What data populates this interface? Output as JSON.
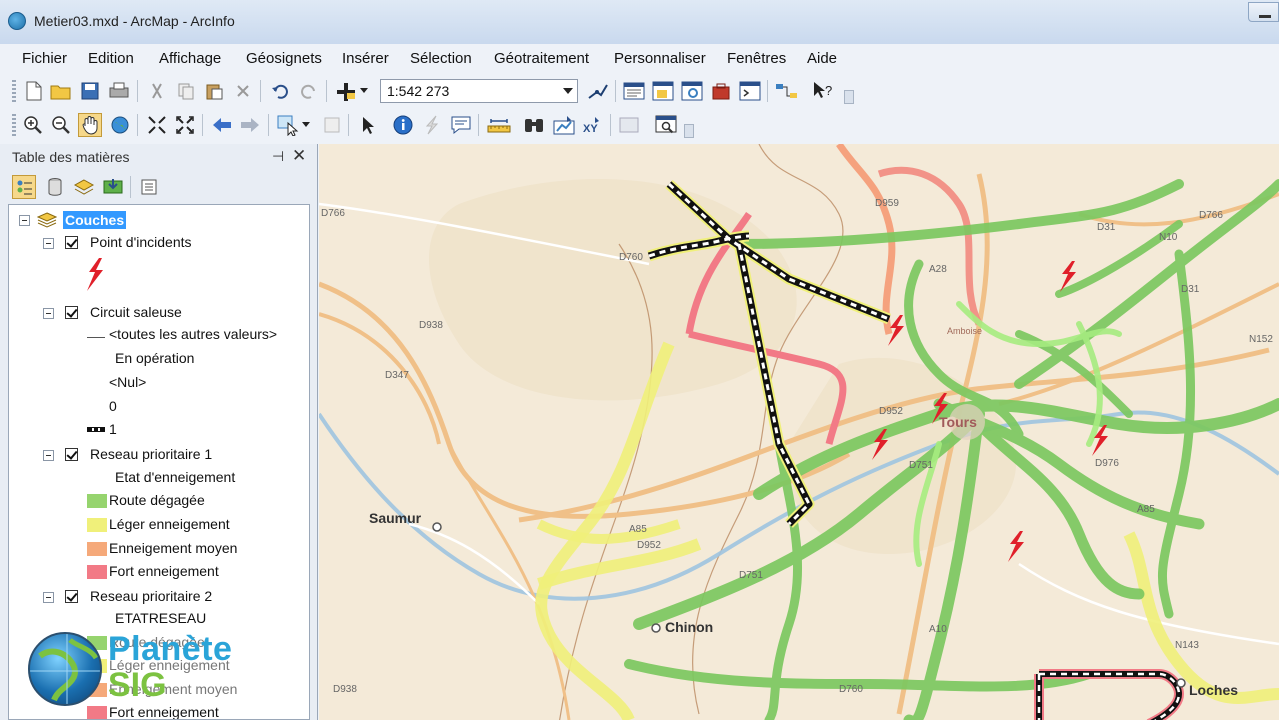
{
  "window": {
    "title": "Metier03.mxd - ArcMap - ArcInfo"
  },
  "menu": [
    "Fichier",
    "Edition",
    "Affichage",
    "Géosignets",
    "Insérer",
    "Sélection",
    "Géotraitement",
    "Personnaliser",
    "Fenêtres",
    "Aide"
  ],
  "toolbar": {
    "scale_value": "1:542 273"
  },
  "toc": {
    "title": "Table des matières",
    "root": "Couches",
    "layer1": {
      "name": "Point d'incidents"
    },
    "layer2": {
      "name": "Circuit saleuse",
      "items": [
        "<toutes les autres valeurs>",
        "En opération",
        "<Nul>",
        "0",
        "1"
      ]
    },
    "layer3": {
      "name": "Reseau prioritaire 1",
      "field": "Etat d'enneigement",
      "classes": [
        {
          "label": "Route dégagée",
          "color": "#96d46e"
        },
        {
          "label": "Léger enneigement",
          "color": "#f0f07a"
        },
        {
          "label": "Enneigement moyen",
          "color": "#f5a97a"
        },
        {
          "label": "Fort enneigement",
          "color": "#f27a86"
        }
      ]
    },
    "layer4": {
      "name": "Reseau prioritaire 2",
      "field": "ETATRESEAU",
      "classes": [
        "Route dégagée",
        "Léger enneigement",
        "Enneigement moyen",
        "Fort enneigement"
      ]
    }
  },
  "logo": {
    "line1": "Planète",
    "line2": "SIG"
  },
  "map": {
    "cities": [
      "Saumur",
      "Chinon",
      "Tours",
      "Loches",
      "Amboise"
    ],
    "road_labels": [
      "D766",
      "D760",
      "D938",
      "D347",
      "A85",
      "D952",
      "D751",
      "D760",
      "D938",
      "D766",
      "D31",
      "A10",
      "N10",
      "D952",
      "D976",
      "A28",
      "D31",
      "D751",
      "N143",
      "A85",
      "N152",
      "D959"
    ]
  }
}
